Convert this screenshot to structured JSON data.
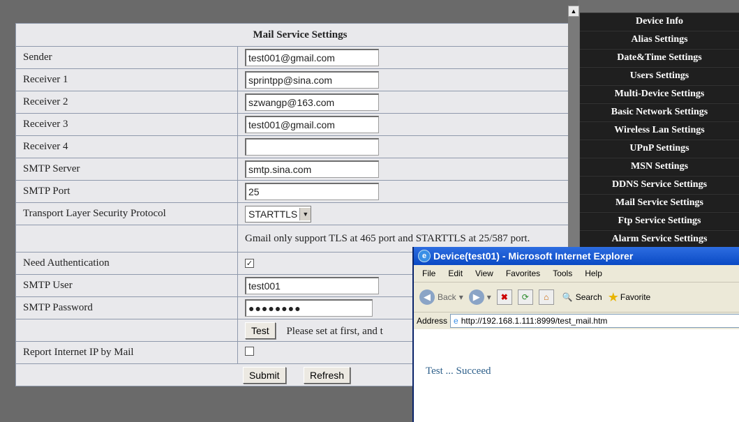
{
  "form": {
    "title": "Mail Service Settings",
    "rows": {
      "sender": {
        "label": "Sender",
        "value": "test001@gmail.com"
      },
      "receiver1": {
        "label": "Receiver 1",
        "value": "sprintpp@sina.com"
      },
      "receiver2": {
        "label": "Receiver 2",
        "value": "szwangp@163.com"
      },
      "receiver3": {
        "label": "Receiver 3",
        "value": "test001@gmail.com"
      },
      "receiver4": {
        "label": "Receiver 4",
        "value": ""
      },
      "smtp_server": {
        "label": "SMTP Server",
        "value": "smtp.sina.com"
      },
      "smtp_port": {
        "label": "SMTP Port",
        "value": "25"
      },
      "tls": {
        "label": "Transport Layer Security Protocol",
        "value": "STARTTLS"
      },
      "tls_note": "Gmail only support TLS at 465 port and STARTTLS at 25/587 port.",
      "need_auth": {
        "label": "Need Authentication",
        "checked": true
      },
      "smtp_user": {
        "label": "SMTP User",
        "value": "test001"
      },
      "smtp_password": {
        "label": "SMTP Password",
        "value": "●●●●●●●●"
      },
      "test": {
        "button": "Test",
        "note": "Please set at first, and t"
      },
      "report_ip": {
        "label": "Report Internet IP by Mail",
        "checked": false
      }
    },
    "submit_label": "Submit",
    "refresh_label": "Refresh"
  },
  "menu": [
    "Device Info",
    "Alias Settings",
    "Date&Time Settings",
    "Users Settings",
    "Multi-Device Settings",
    "Basic Network Settings",
    "Wireless Lan Settings",
    "UPnP Settings",
    "MSN Settings",
    "DDNS Service Settings",
    "Mail Service Settings",
    "Ftp Service Settings",
    "Alarm Service Settings"
  ],
  "popup": {
    "title": "Device(test01) - Microsoft Internet Explorer",
    "menubar": [
      "File",
      "Edit",
      "View",
      "Favorites",
      "Tools",
      "Help"
    ],
    "toolbar": {
      "back": "Back",
      "search": "Search",
      "favorites": "Favorite"
    },
    "address_label": "Address",
    "url": "http://192.168.1.111:8999/test_mail.htm",
    "message": "Test ... Succeed"
  }
}
